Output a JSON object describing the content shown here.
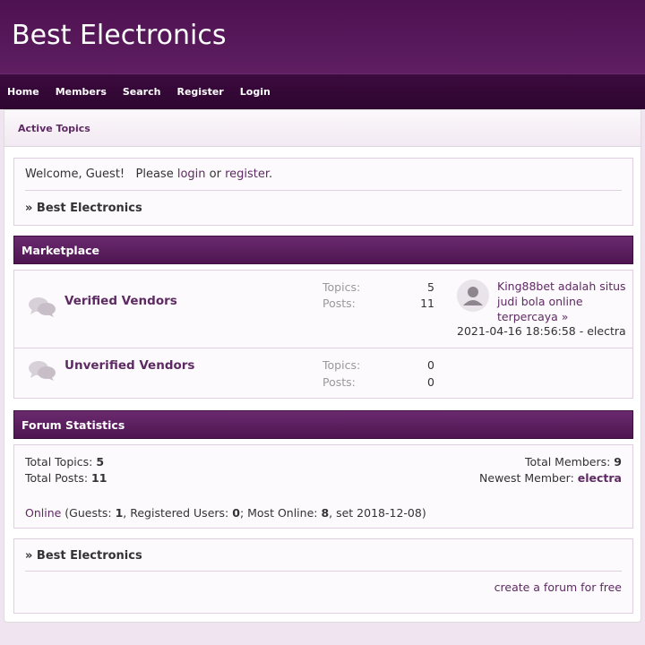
{
  "site": {
    "title": "Best Electronics"
  },
  "nav": [
    "Home",
    "Members",
    "Search",
    "Register",
    "Login"
  ],
  "subnav": {
    "active_topics": "Active Topics"
  },
  "welcome": {
    "prefix": "Welcome, Guest!   Please ",
    "login": "login",
    "or": " or ",
    "register": "register",
    "suffix": ".",
    "breadcrumb": "» Best Electronics"
  },
  "category": {
    "name": "Marketplace",
    "forums": [
      {
        "name": "Verified Vendors",
        "topics_label": "Topics:",
        "topics": "5",
        "posts_label": "Posts:",
        "posts": "11",
        "last_post_title": "King88bet adalah situs judi bola online terpercaya",
        "last_post_arrow": "»",
        "last_post_meta": "2021-04-16 18:56:58 - electra"
      },
      {
        "name": "Unverified Vendors",
        "topics_label": "Topics:",
        "topics": "0",
        "posts_label": "Posts:",
        "posts": "0"
      }
    ]
  },
  "stats": {
    "heading": "Forum Statistics",
    "total_topics_label": "Total Topics: ",
    "total_topics": "5",
    "total_posts_label": "Total Posts: ",
    "total_posts": "11",
    "total_members_label": "Total Members: ",
    "total_members": "9",
    "newest_member_label": "Newest Member: ",
    "newest_member": "electra",
    "online_link": "Online",
    "guests_label": " (Guests: ",
    "guests": "1",
    "registered_label": ", Registered Users: ",
    "registered": "0",
    "most_online_label": "; Most Online: ",
    "most_online": "8",
    "most_online_date": ", set 2018-12-08)"
  },
  "footer": {
    "breadcrumb": "» Best Electronics",
    "cta": "create a forum for free"
  },
  "colors": {
    "brand": "#5e1e61",
    "nav_bg": "#2d062f",
    "link": "#5e2a63"
  },
  "icons": {
    "forum": "speech-bubbles-icon",
    "avatar": "user-silhouette-icon"
  }
}
